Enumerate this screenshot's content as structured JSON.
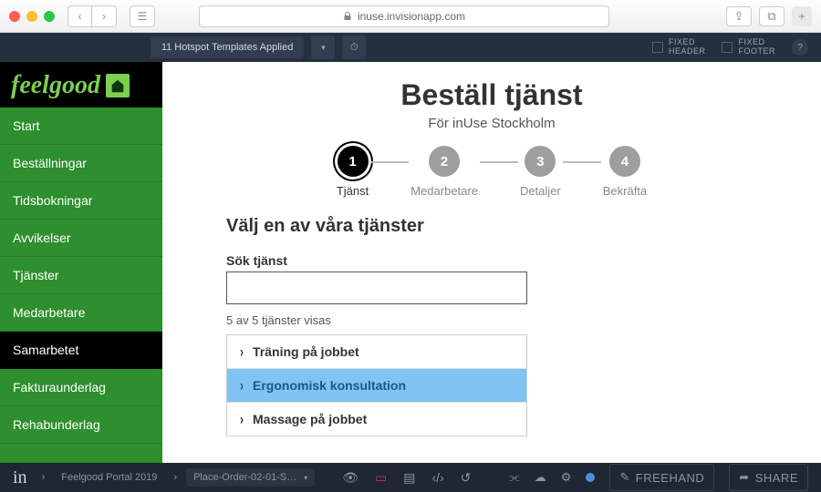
{
  "browser": {
    "url": "inuse.invisionapp.com"
  },
  "invision_top": {
    "hotspot_label": "11 Hotspot Templates Applied",
    "fixed_header": "FIXED\nHEADER",
    "fixed_footer": "FIXED\nFOOTER"
  },
  "logo_text": "feelgood",
  "sidebar": {
    "items": [
      {
        "label": "Start",
        "active": false
      },
      {
        "label": "Beställningar",
        "active": false
      },
      {
        "label": "Tidsbokningar",
        "active": false
      },
      {
        "label": "Avvikelser",
        "active": false
      },
      {
        "label": "Tjänster",
        "active": false
      },
      {
        "label": "Medarbetare",
        "active": false
      },
      {
        "label": "Samarbetet",
        "active": true
      },
      {
        "label": "Fakturaunderlag",
        "active": false
      },
      {
        "label": "Rehabunderlag",
        "active": false
      }
    ]
  },
  "page": {
    "title": "Beställ tjänst",
    "subtitle": "För inUse Stockholm",
    "steps": [
      {
        "num": "1",
        "label": "Tjänst",
        "active": true
      },
      {
        "num": "2",
        "label": "Medarbetare",
        "active": false
      },
      {
        "num": "3",
        "label": "Detaljer",
        "active": false
      },
      {
        "num": "4",
        "label": "Bekräfta",
        "active": false
      }
    ],
    "section_heading": "Välj en av våra tjänster",
    "search_label": "Sök tjänst",
    "search_value": "",
    "result_count": "5 av 5 tjänster visas",
    "services": [
      {
        "label": "Träning på jobbet",
        "selected": false
      },
      {
        "label": "Ergonomisk konsultation",
        "selected": true
      },
      {
        "label": "Massage på jobbet",
        "selected": false
      }
    ]
  },
  "invision_bottom": {
    "project": "Feelgood Portal 2019",
    "screen": "Place-Order-02-01-S…",
    "freehand": "FREEHAND",
    "share": "SHARE"
  }
}
